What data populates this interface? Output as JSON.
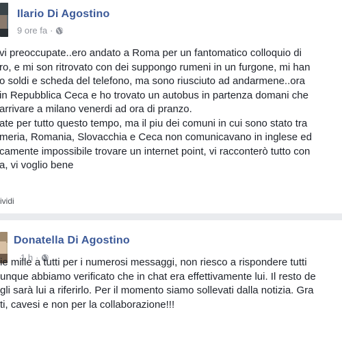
{
  "post1": {
    "author": "Ilario Di Agostino",
    "time": "9 ore fa",
    "separator": "·",
    "privacy_icon": "globe-icon",
    "lines": [
      "vi preoccupate..ero andato a Roma per un fantomatico colloquio di",
      "ro, e mi son ritrovato con dei suppongo rumeni in un furgone, mi han",
      "o soldi e scheda del telefono, ma sono riusciuto ad andarmene..ora",
      "in Repubblica Ceca e ho trovato un autobus in partenza domani che",
      "arrivare a milano venerdi ad ora di pranzo.",
      "ate per tutto questo tempo, ma il piu dei comuni in cui sono stato tra",
      "meria, Romania, Slovacchia e Ceca non comunicavano in inglese ed",
      "camente impossibile trovare un internet point, vi racconterò tutto con",
      "a, vi voglio bene"
    ],
    "share_label": "ividi"
  },
  "post2": {
    "author": "Donatella Di Agostino",
    "time": "1 h",
    "separator": "·",
    "privacy_icon": "globe-icon",
    "lines": [
      "ie mille a tutti per i numerosi messaggi, non riesco a rispondere tutti",
      "unque abbiamo verificato che in chat era effettivamente lui. Il resto de",
      "gli sarà lui a riferirlo. Per il momento siamo sollevati dalla notizia. Gra",
      "ti, cavesi e non per la collaborazione!!!"
    ]
  },
  "colors": {
    "author_link": "#3b5998",
    "background": "#e9ebee",
    "text": "#1d2129",
    "meta": "#90949c"
  }
}
